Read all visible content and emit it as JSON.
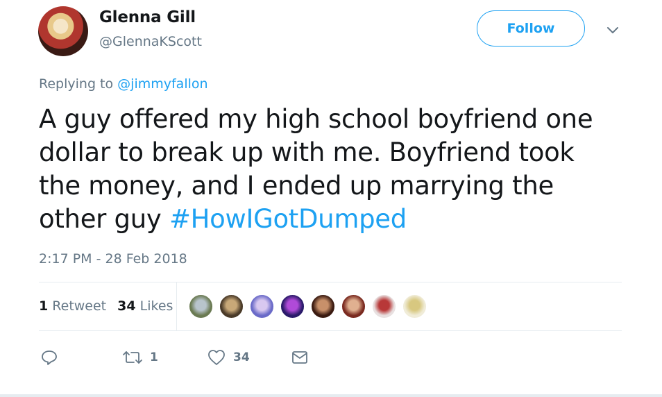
{
  "user": {
    "name": "Glenna Gill",
    "handle": "@GlennaKScott"
  },
  "follow_label": "Follow",
  "reply": {
    "prefix": "Replying to",
    "mention": "@jimmyfallon"
  },
  "tweet": {
    "text": "A guy offered my high school boyfriend one dollar to break up with me. Boyfriend took the money, and I ended up marrying the other guy ",
    "hashtag": "#HowIGotDumped"
  },
  "timestamp": "2:17 PM - 28 Feb 2018",
  "stats": {
    "retweet_count": "1",
    "retweet_label": "Retweet",
    "like_count": "34",
    "like_label": "Likes"
  },
  "likers": [
    {
      "colors": [
        "#6a7a52",
        "#b8c4cc"
      ]
    },
    {
      "colors": [
        "#4a3a28",
        "#c8a878"
      ]
    },
    {
      "colors": [
        "#6a6ac8",
        "#d8c8f0"
      ]
    },
    {
      "colors": [
        "#2a1a6a",
        "#b04ad8"
      ]
    },
    {
      "colors": [
        "#3a1a10",
        "#c8906a"
      ]
    },
    {
      "colors": [
        "#7a2a20",
        "#e0b090"
      ]
    },
    {
      "colors": [
        "#e8e0e0",
        "#b83838"
      ]
    },
    {
      "colors": [
        "#f0ecd8",
        "#d8c880"
      ]
    }
  ],
  "actions": {
    "reply_icon": "reply-icon",
    "retweet_count": "1",
    "like_count": "34",
    "dm_icon": "envelope-icon"
  },
  "colors": {
    "accent": "#1da1f2",
    "muted": "#657786",
    "text": "#14171a"
  }
}
